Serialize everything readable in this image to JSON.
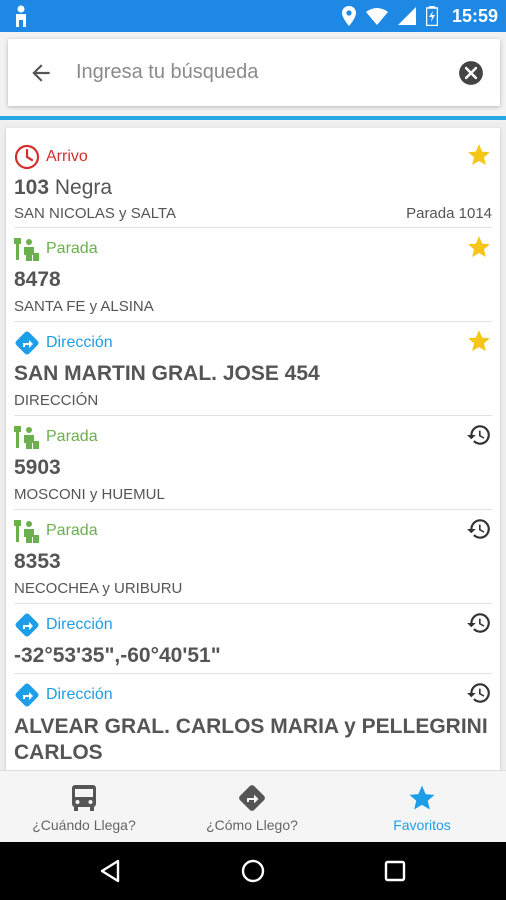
{
  "status_bar": {
    "time": "15:59",
    "background": "#1e88e5"
  },
  "search": {
    "placeholder": "Ingresa tu búsqueda"
  },
  "colors": {
    "arrivo": "#d32f2f",
    "parada": "#6ab04c",
    "direccion": "#1e9ee8",
    "star": "#f5c518"
  },
  "results": [
    {
      "type": "Arrivo",
      "type_icon": "clock-icon",
      "corner_icon": "star-icon",
      "title": "103",
      "title_extra": "Negra",
      "subtitle": "SAN NICOLAS y SALTA",
      "right_note": "Parada 1014"
    },
    {
      "type": "Parada",
      "type_icon": "bus-stop-icon",
      "corner_icon": "star-icon",
      "title": "8478",
      "subtitle": "SANTA FE y ALSINA"
    },
    {
      "type": "Dirección",
      "type_icon": "direction-icon",
      "corner_icon": "star-icon",
      "title": "SAN MARTIN GRAL. JOSE 454",
      "subtitle": "DIRECCIÓN"
    },
    {
      "type": "Parada",
      "type_icon": "bus-stop-icon",
      "corner_icon": "history-icon",
      "title": "5903",
      "subtitle": "MOSCONI y HUEMUL"
    },
    {
      "type": "Parada",
      "type_icon": "bus-stop-icon",
      "corner_icon": "history-icon",
      "title": "8353",
      "subtitle": "NECOCHEA y URIBURU"
    },
    {
      "type": "Dirección",
      "type_icon": "direction-icon",
      "corner_icon": "history-icon",
      "title": "-32°53'35\",-60°40'51\""
    },
    {
      "type": "Dirección",
      "type_icon": "direction-icon",
      "corner_icon": "history-icon",
      "title": "ALVEAR  GRAL. CARLOS MARIA y PELLEGRINI CARLOS"
    }
  ],
  "bottom_nav": [
    {
      "label": "¿Cuándo Llega?",
      "icon": "bus-icon"
    },
    {
      "label": "¿Cómo Llego?",
      "icon": "route-icon"
    },
    {
      "label": "Favoritos",
      "icon": "star-icon",
      "active": true
    }
  ]
}
